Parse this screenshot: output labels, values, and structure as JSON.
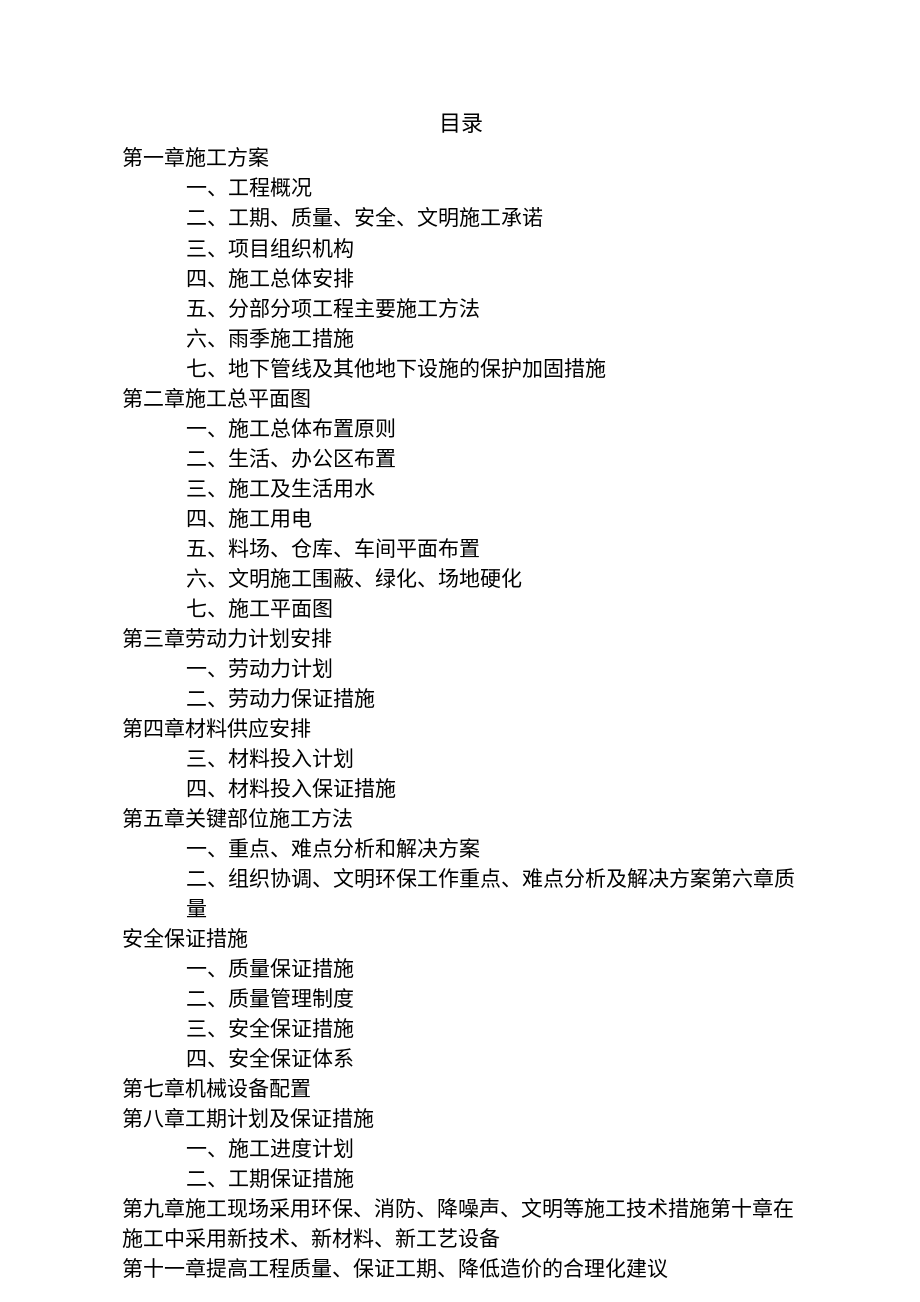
{
  "title": "目录",
  "lines": [
    {
      "text": "第一章施工方案",
      "cls": "chapter"
    },
    {
      "text": "一、工程概况",
      "cls": "item"
    },
    {
      "text": "二、工期、质量、安全、文明施工承诺",
      "cls": "item"
    },
    {
      "text": "三、项目组织机构",
      "cls": "item"
    },
    {
      "text": "四、施工总体安排",
      "cls": "item"
    },
    {
      "text": "五、分部分项工程主要施工方法",
      "cls": "item"
    },
    {
      "text": "六、雨季施工措施",
      "cls": "item"
    },
    {
      "text": "七、地下管线及其他地下设施的保护加固措施",
      "cls": "item"
    },
    {
      "text": "第二章施工总平面图",
      "cls": "chapter"
    },
    {
      "text": "一、施工总体布置原则",
      "cls": "item"
    },
    {
      "text": "二、生活、办公区布置",
      "cls": "item"
    },
    {
      "text": "三、施工及生活用水",
      "cls": "item"
    },
    {
      "text": "四、施工用电",
      "cls": "item"
    },
    {
      "text": "五、料场、仓库、车间平面布置",
      "cls": "item"
    },
    {
      "text": "六、文明施工围蔽、绿化、场地硬化",
      "cls": "item"
    },
    {
      "text": "七、施工平面图",
      "cls": "item"
    },
    {
      "text": "第三章劳动力计划安排",
      "cls": "chapter"
    },
    {
      "text": "一、劳动力计划",
      "cls": "item"
    },
    {
      "text": "二、劳动力保证措施",
      "cls": "item"
    },
    {
      "text": "第四章材料供应安排",
      "cls": "chapter"
    },
    {
      "text": "三、材料投入计划",
      "cls": "item"
    },
    {
      "text": "四、材料投入保证措施",
      "cls": "item"
    },
    {
      "text": "第五章关键部位施工方法",
      "cls": "chapter"
    },
    {
      "text": "一、重点、难点分析和解决方案",
      "cls": "item"
    },
    {
      "text": "二、组织协调、文明环保工作重点、难点分析及解决方案第六章质量",
      "cls": "item"
    },
    {
      "text": "安全保证措施",
      "cls": "continued"
    },
    {
      "text": "一、质量保证措施",
      "cls": "item"
    },
    {
      "text": "二、质量管理制度",
      "cls": "item"
    },
    {
      "text": "三、安全保证措施",
      "cls": "item"
    },
    {
      "text": "四、安全保证体系",
      "cls": "item"
    },
    {
      "text": "第七章机械设备配置",
      "cls": "chapter"
    },
    {
      "text": "第八章工期计划及保证措施",
      "cls": "chapter"
    },
    {
      "text": "一、施工进度计划",
      "cls": "item"
    },
    {
      "text": "二、工期保证措施",
      "cls": "item"
    },
    {
      "text": "第九章施工现场采用环保、消防、降噪声、文明等施工技术措施第十章在",
      "cls": "chapter"
    },
    {
      "text": "施工中采用新技术、新材料、新工艺设备",
      "cls": "continued"
    },
    {
      "text": "第十一章提高工程质量、保证工期、降低造价的合理化建议",
      "cls": "chapter"
    }
  ]
}
